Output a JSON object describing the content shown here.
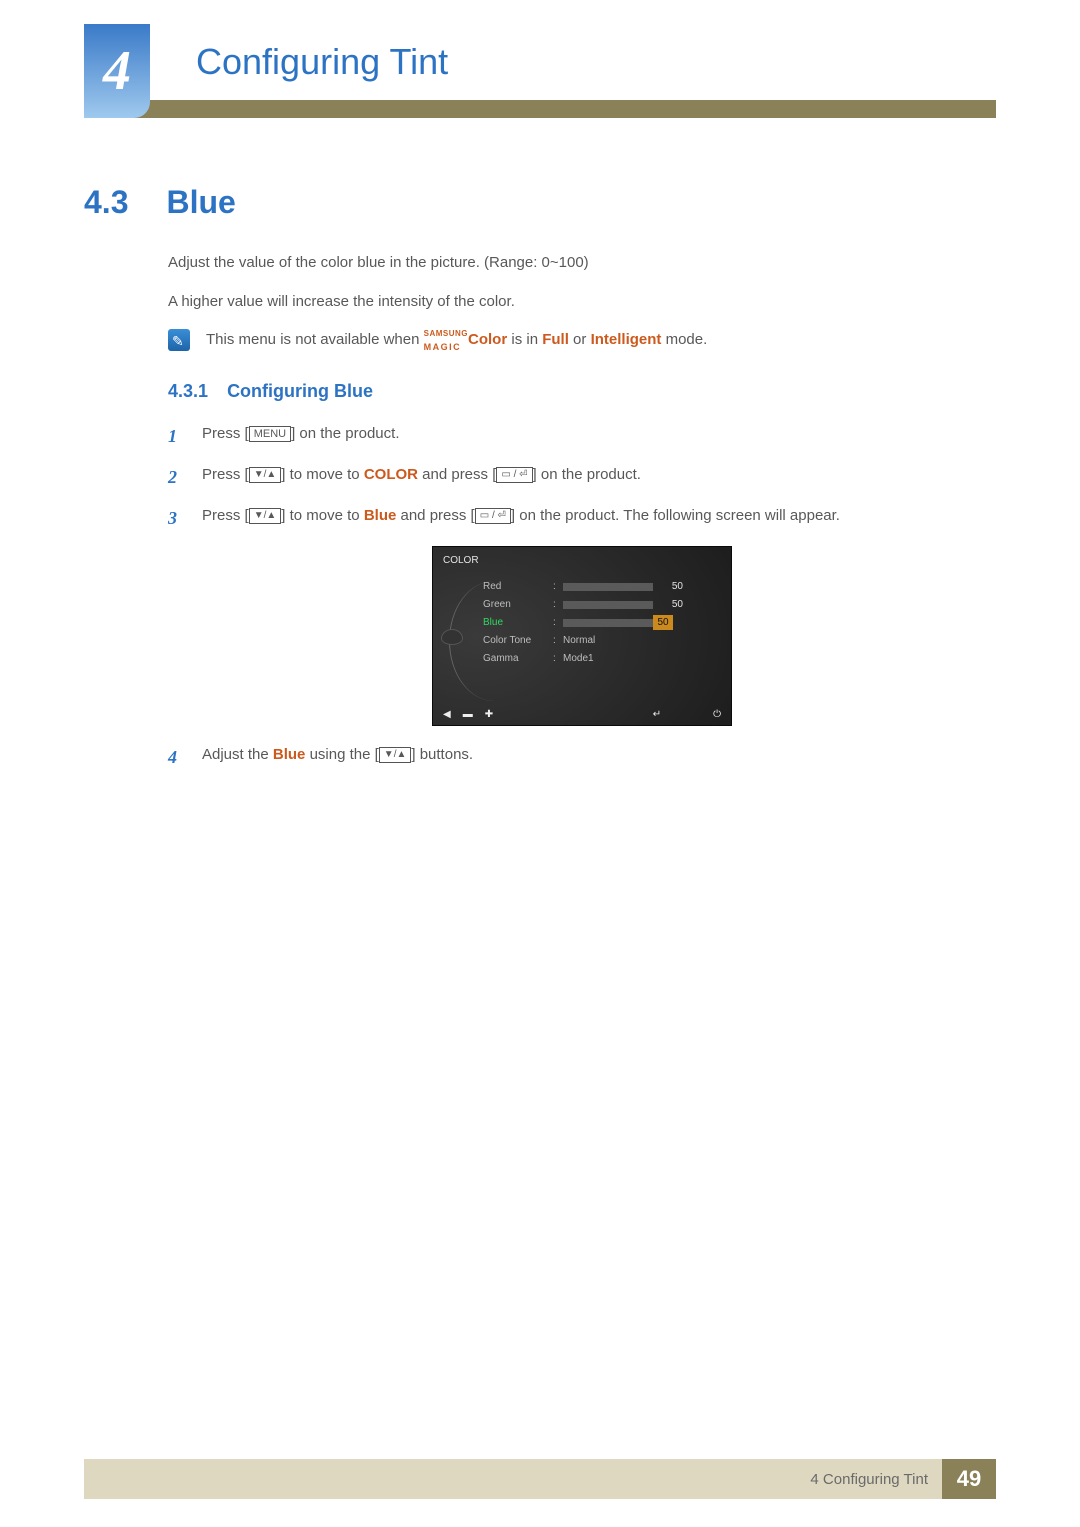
{
  "header": {
    "chapter_number": "4",
    "chapter_title": "Configuring Tint"
  },
  "section": {
    "number": "4.3",
    "title": "Blue",
    "desc1": "Adjust the value of the color blue in the picture. (Range: 0~100)",
    "desc2": "A higher value will increase the intensity of the color."
  },
  "note": {
    "prefix": "This menu is not available when ",
    "magic_top": "SAMSUNG",
    "magic_bottom": "MAGIC",
    "magic_word": "Color",
    "mid1": " is in ",
    "full": "Full",
    "mid2": " or ",
    "intelligent": "Intelligent",
    "suffix": " mode."
  },
  "subsection": {
    "number": "4.3.1",
    "title": "Configuring Blue"
  },
  "steps": {
    "s1": {
      "n": "1",
      "a": "Press [",
      "menu": "MENU",
      "b": "] on the product."
    },
    "s2": {
      "n": "2",
      "a": "Press [",
      "b": "] to move to ",
      "color": "COLOR",
      "c": " and press [",
      "d": "] on the product."
    },
    "s3": {
      "n": "3",
      "a": "Press [",
      "b": "] to move to ",
      "blue": "Blue",
      "c": " and press [",
      "d": "] on the product. The following screen will appear."
    },
    "s4": {
      "n": "4",
      "a": "Adjust the ",
      "blue": "Blue",
      "b": " using the [",
      "c": "] buttons."
    }
  },
  "osd": {
    "title": "COLOR",
    "rows": [
      {
        "label": "Red",
        "value": "50",
        "fill": 50,
        "type": "bar"
      },
      {
        "label": "Green",
        "value": "50",
        "fill": 50,
        "type": "bar"
      },
      {
        "label": "Blue",
        "value": "50",
        "fill": 50,
        "type": "bar",
        "selected": true
      },
      {
        "label": "Color Tone",
        "value": "Normal",
        "type": "text"
      },
      {
        "label": "Gamma",
        "value": "Mode1",
        "type": "text"
      }
    ],
    "footer_icons": [
      "◀",
      "▬",
      "✚",
      "↵",
      "⏻"
    ]
  },
  "footer": {
    "text": "4 Configuring Tint",
    "page": "49"
  },
  "glyphs": {
    "updown": "▼/▲",
    "srcenter": "▭ / ⏎"
  }
}
